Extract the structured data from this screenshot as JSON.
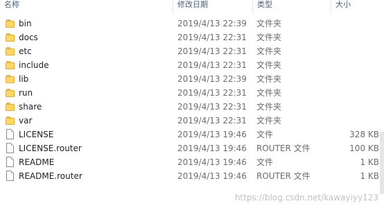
{
  "columns": {
    "name": "名称",
    "date": "修改日期",
    "type": "类型",
    "size": "大小"
  },
  "items": [
    {
      "icon": "folder-icon",
      "name": "bin",
      "date": "2019/4/13 22:39",
      "type": "文件夹",
      "size": ""
    },
    {
      "icon": "folder-icon",
      "name": "docs",
      "date": "2019/4/13 22:31",
      "type": "文件夹",
      "size": ""
    },
    {
      "icon": "folder-icon",
      "name": "etc",
      "date": "2019/4/13 22:31",
      "type": "文件夹",
      "size": ""
    },
    {
      "icon": "folder-icon",
      "name": "include",
      "date": "2019/4/13 22:31",
      "type": "文件夹",
      "size": ""
    },
    {
      "icon": "folder-icon",
      "name": "lib",
      "date": "2019/4/13 22:39",
      "type": "文件夹",
      "size": ""
    },
    {
      "icon": "folder-icon",
      "name": "run",
      "date": "2019/4/13 22:31",
      "type": "文件夹",
      "size": ""
    },
    {
      "icon": "folder-icon",
      "name": "share",
      "date": "2019/4/13 22:31",
      "type": "文件夹",
      "size": ""
    },
    {
      "icon": "folder-icon",
      "name": "var",
      "date": "2019/4/13 22:31",
      "type": "文件夹",
      "size": ""
    },
    {
      "icon": "file-icon",
      "name": "LICENSE",
      "date": "2019/4/13 19:46",
      "type": "文件",
      "size": "328 KB"
    },
    {
      "icon": "file-icon",
      "name": "LICENSE.router",
      "date": "2019/4/13 19:46",
      "type": "ROUTER 文件",
      "size": "100 KB"
    },
    {
      "icon": "file-icon",
      "name": "README",
      "date": "2019/4/13 19:46",
      "type": "文件",
      "size": "1 KB"
    },
    {
      "icon": "file-icon",
      "name": "README.router",
      "date": "2019/4/13 19:46",
      "type": "ROUTER 文件",
      "size": "1 KB"
    }
  ],
  "watermark": "https://blog.csdn.net/kawayiyy123"
}
